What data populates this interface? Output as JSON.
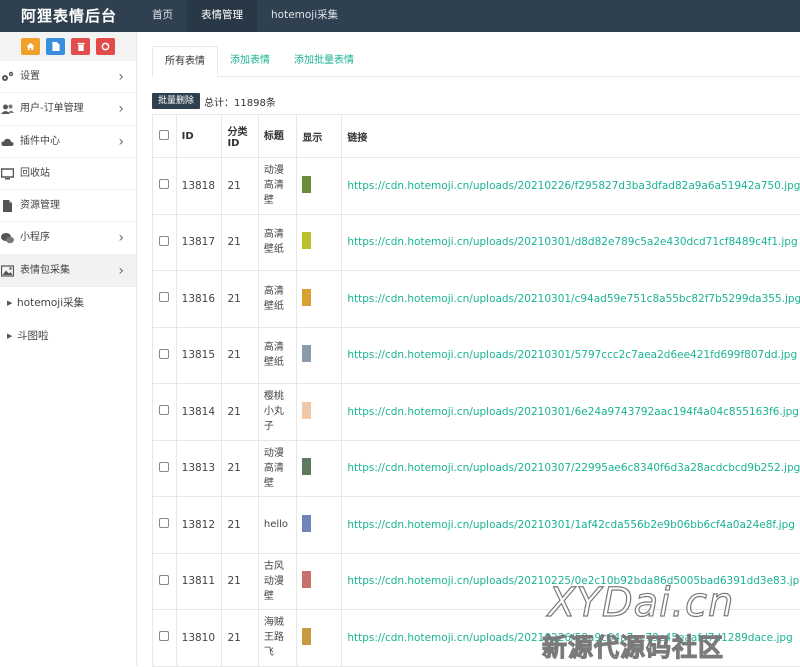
{
  "app": {
    "title": "阿狸表情后台"
  },
  "topnav": {
    "items": [
      "首页",
      "表情管理",
      "hotemoji采集"
    ]
  },
  "sidebar": {
    "toolbar": [
      {
        "icon": "home-icon",
        "color": "#f0a02b"
      },
      {
        "icon": "file-icon",
        "color": "#3a8fdc"
      },
      {
        "icon": "trash-icon",
        "color": "#e14c4c"
      },
      {
        "icon": "recycle-icon",
        "color": "#e34b4b"
      }
    ],
    "menu": [
      {
        "label": "设置",
        "icon": "gears-icon"
      },
      {
        "label": "用户-订单管理",
        "icon": "users-icon"
      },
      {
        "label": "插件中心",
        "icon": "cloud-icon"
      },
      {
        "label": "回收站",
        "icon": "monitor-icon"
      },
      {
        "label": "资源管理",
        "icon": "document-icon"
      },
      {
        "label": "小程序",
        "icon": "wechat-icon"
      },
      {
        "label": "表情包采集",
        "icon": "image-icon"
      }
    ],
    "submenu": [
      "hotemoji采集",
      "斗图啦"
    ]
  },
  "tabs": [
    "所有表情",
    "添加表情",
    "添加批量表情"
  ],
  "actions": {
    "batch_delete": "批量删除",
    "total": "总计：11898条"
  },
  "table": {
    "headers": {
      "id": "ID",
      "category": "分类ID",
      "title": "标题",
      "image": "显示",
      "link": "链接"
    },
    "rows": [
      {
        "id": "13818",
        "category": "21",
        "title": "动漫高清壁",
        "color": "#6b8d3a",
        "link": "https://cdn.hotemoji.cn/uploads/20210226/f295827d3ba3dfad82a9a6a51942a750.jpg"
      },
      {
        "id": "13817",
        "category": "21",
        "title": "高清壁纸",
        "color": "#b8c02a",
        "link": "https://cdn.hotemoji.cn/uploads/20210301/d8d82e789c5a2e430dcd71cf8489c4f1.jpg"
      },
      {
        "id": "13816",
        "category": "21",
        "title": "高清壁纸",
        "color": "#d8a030",
        "link": "https://cdn.hotemoji.cn/uploads/20210301/c94ad59e751c8a55bc82f7b5299da355.jpg"
      },
      {
        "id": "13815",
        "category": "21",
        "title": "高清壁纸",
        "color": "#8a9aa8",
        "link": "https://cdn.hotemoji.cn/uploads/20210301/5797ccc2c7aea2d6ee421fd699f807dd.jpg"
      },
      {
        "id": "13814",
        "category": "21",
        "title": "樱桃小丸子",
        "color": "#f2c9a8",
        "link": "https://cdn.hotemoji.cn/uploads/20210301/6e24a9743792aac194f4a04c855163f6.jpg"
      },
      {
        "id": "13813",
        "category": "21",
        "title": "动漫高清壁",
        "color": "#5e7860",
        "link": "https://cdn.hotemoji.cn/uploads/20210307/22995ae6c8340f6d3a28acdcbcd9b252.jpg"
      },
      {
        "id": "13812",
        "category": "21",
        "title": "hello",
        "color": "#6f85b8",
        "link": "https://cdn.hotemoji.cn/uploads/20210301/1af42cda556b2e9b06bb6cf4a0a24e8f.jpg"
      },
      {
        "id": "13811",
        "category": "21",
        "title": "古风动漫壁",
        "color": "#c8706a",
        "link": "https://cdn.hotemoji.cn/uploads/20210225/0e2c10b92bda86d5005bad6391dd3e83.jpg"
      },
      {
        "id": "13810",
        "category": "21",
        "title": "海贼王路飞",
        "color": "#c89a40",
        "link": "https://cdn.hotemoji.cn/uploads/20210226/58a9c64a7ec79c45eaafd7d1289dace.jpg"
      }
    ]
  },
  "watermark": {
    "line1": "XYDai.cn",
    "line2": "新源代源码社区"
  }
}
